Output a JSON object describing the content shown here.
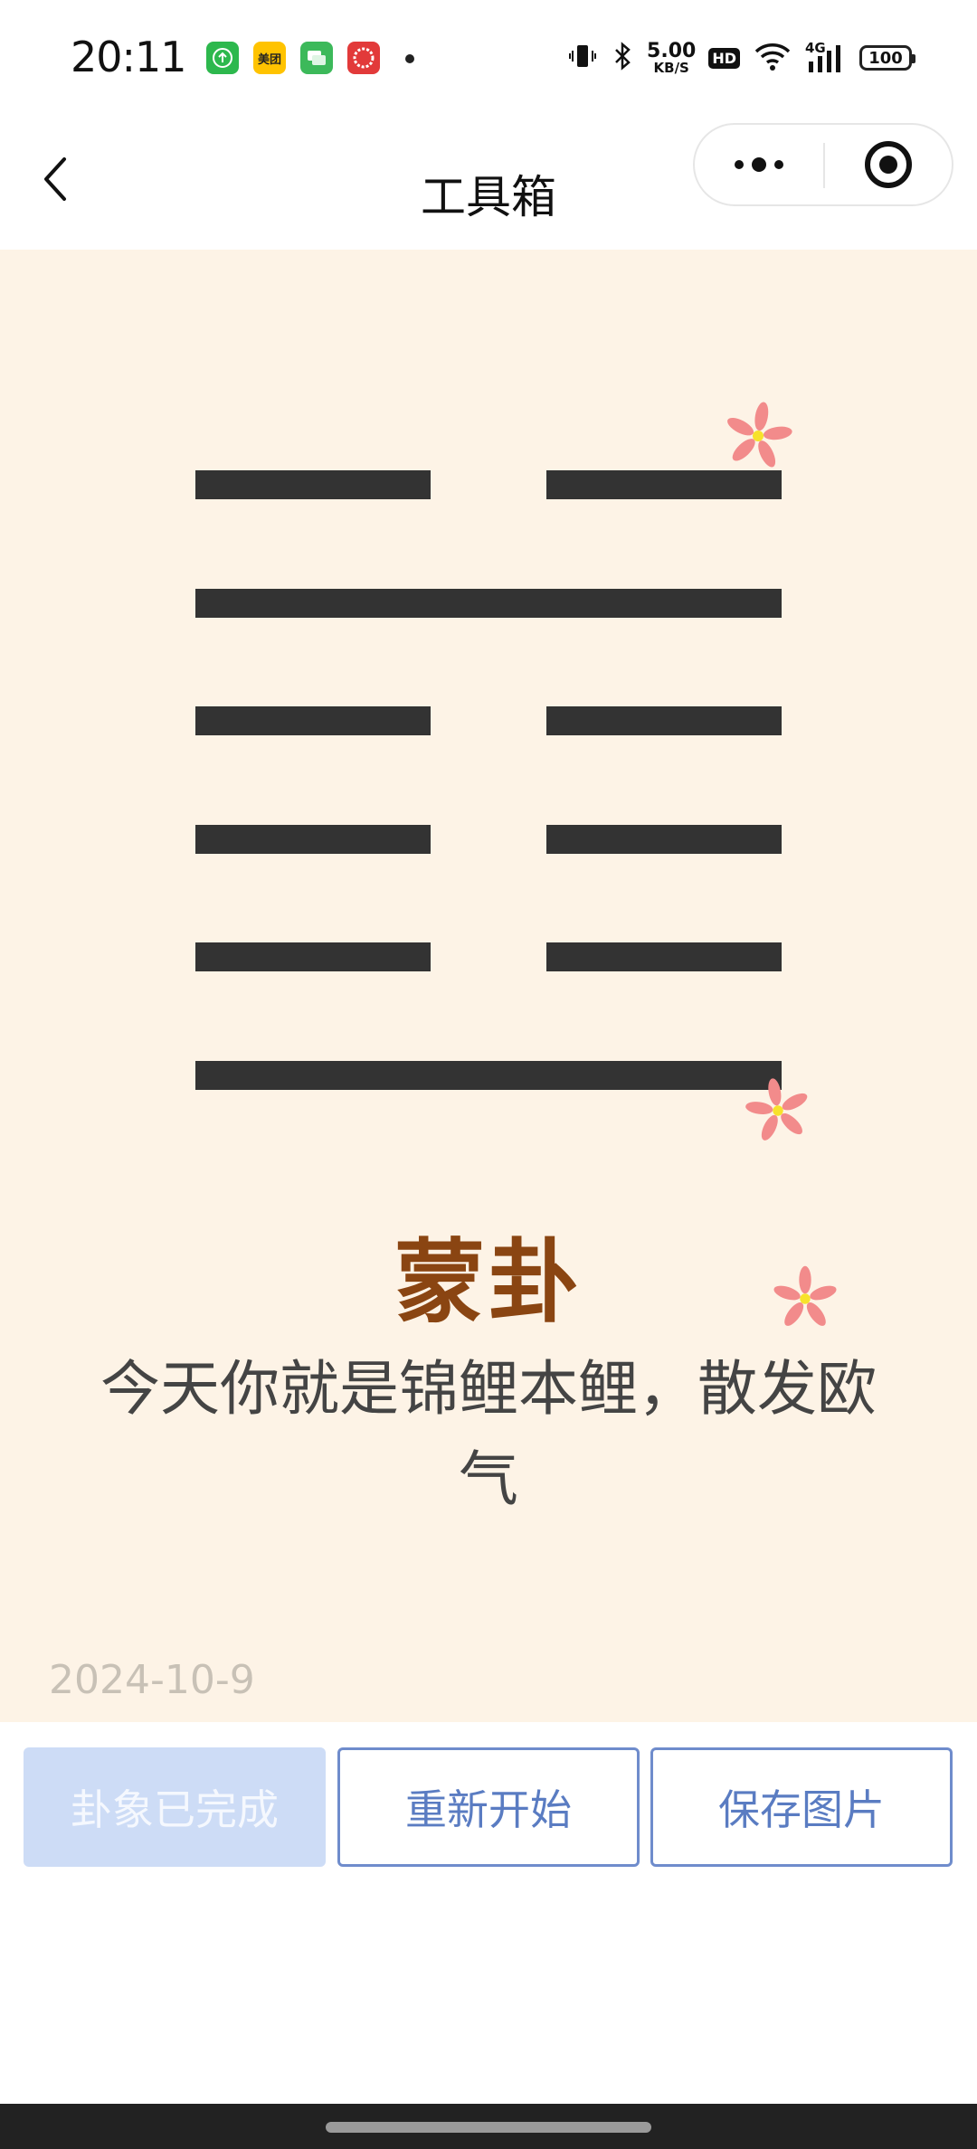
{
  "status_bar": {
    "time": "20:11",
    "app_icons": [
      "up-arrow-app-icon",
      "meituan-icon",
      "message-app-icon",
      "red-app-icon"
    ],
    "meituan_label": "美团",
    "net_speed_value": "5.00",
    "net_speed_unit": "KB/S",
    "hd_label": "HD",
    "network_label": "4G",
    "battery_level": "100"
  },
  "nav": {
    "title": "工具箱"
  },
  "hexagram": {
    "lines": [
      "broken",
      "solid",
      "broken",
      "broken",
      "broken",
      "solid"
    ],
    "name": "蒙卦",
    "description": "今天你就是锦鲤本鲤，散发欧气",
    "date": "2024-10-9"
  },
  "buttons": {
    "done_label": "卦象已完成",
    "restart_label": "重新开始",
    "save_label": "保存图片"
  },
  "colors": {
    "card_background": "#fdf3e6",
    "line_color": "#333333",
    "title_color": "#8a4512",
    "button_accent": "#5a7cc2",
    "button_disabled": "#cddcf6",
    "flower_petal": "#f28b8b",
    "flower_center": "#f7e22b"
  }
}
